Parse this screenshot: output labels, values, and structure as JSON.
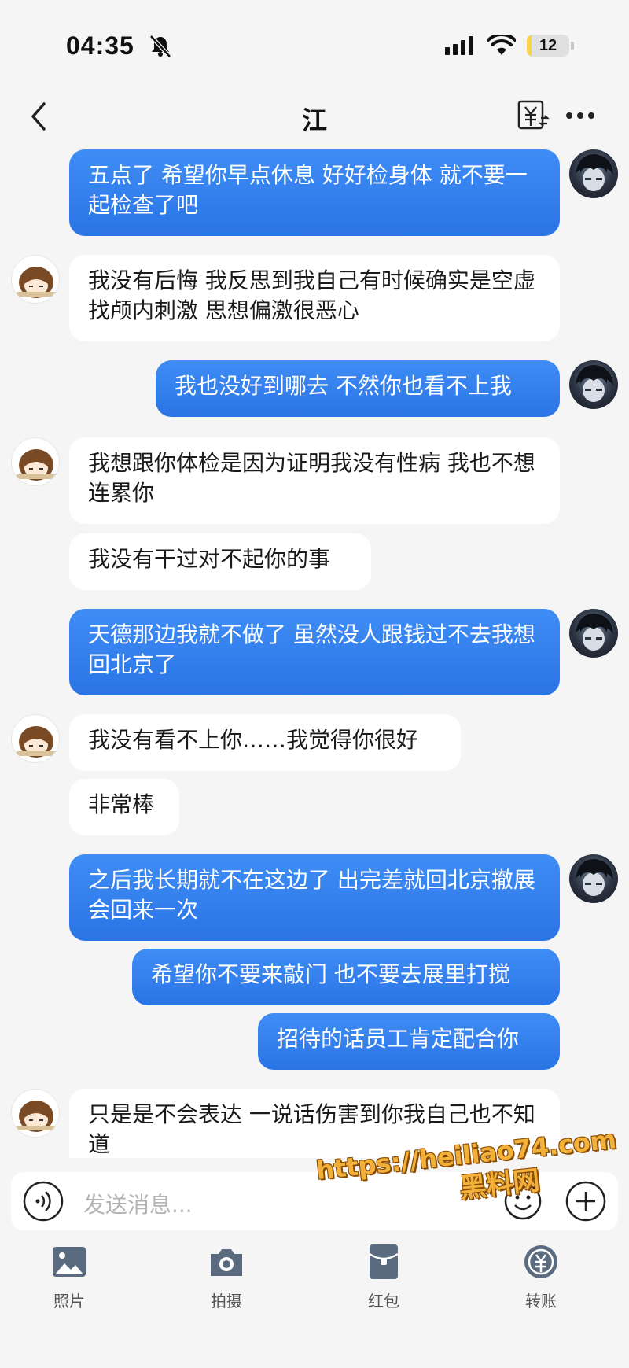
{
  "status": {
    "time": "04:35",
    "battery": "12",
    "battery_level": 0.12
  },
  "nav": {
    "title": "江"
  },
  "messages": [
    {
      "side": "me",
      "text": "五点了 希望你早点休息 好好检身体 就不要一起检查了吧"
    },
    {
      "side": "them",
      "text": "我没有后悔 我反思到我自己有时候确实是空虚 找颅内刺激 思想偏激很恶心"
    },
    {
      "side": "me",
      "text": "我也没好到哪去 不然你也看不上我"
    },
    {
      "side": "them",
      "text": "我想跟你体检是因为证明我没有性病 我也不想连累你"
    },
    {
      "side": "them",
      "text": "我没有干过对不起你的事"
    },
    {
      "side": "me",
      "text": "天德那边我就不做了 虽然没人跟钱过不去我想回北京了"
    },
    {
      "side": "them",
      "text": "我没有看不上你……我觉得你很好"
    },
    {
      "side": "them",
      "text": "非常棒"
    },
    {
      "side": "me",
      "text": "之后我长期就不在这边了 出完差就回北京撤展会回来一次"
    },
    {
      "side": "me",
      "text": "希望你不要来敲门 也不要去展里打搅"
    },
    {
      "side": "me",
      "text": "招待的话员工肯定配合你"
    },
    {
      "side": "them",
      "text": "只是是不会表达 一说话伤害到你我自己也不知道"
    }
  ],
  "input": {
    "placeholder": "发送消息..."
  },
  "toolbar": [
    {
      "label": "照片",
      "icon": "image-icon"
    },
    {
      "label": "拍摄",
      "icon": "camera-icon"
    },
    {
      "label": "红包",
      "icon": "red-packet-icon"
    },
    {
      "label": "转账",
      "icon": "transfer-icon"
    }
  ],
  "watermark": {
    "url": "https://heiliao74.com",
    "name": "黑料网"
  },
  "colors": {
    "me_bubble": "#3f8df5",
    "them_bubble": "#ffffff",
    "background": "#f5f5f5",
    "watermark": "#f2b13a"
  }
}
